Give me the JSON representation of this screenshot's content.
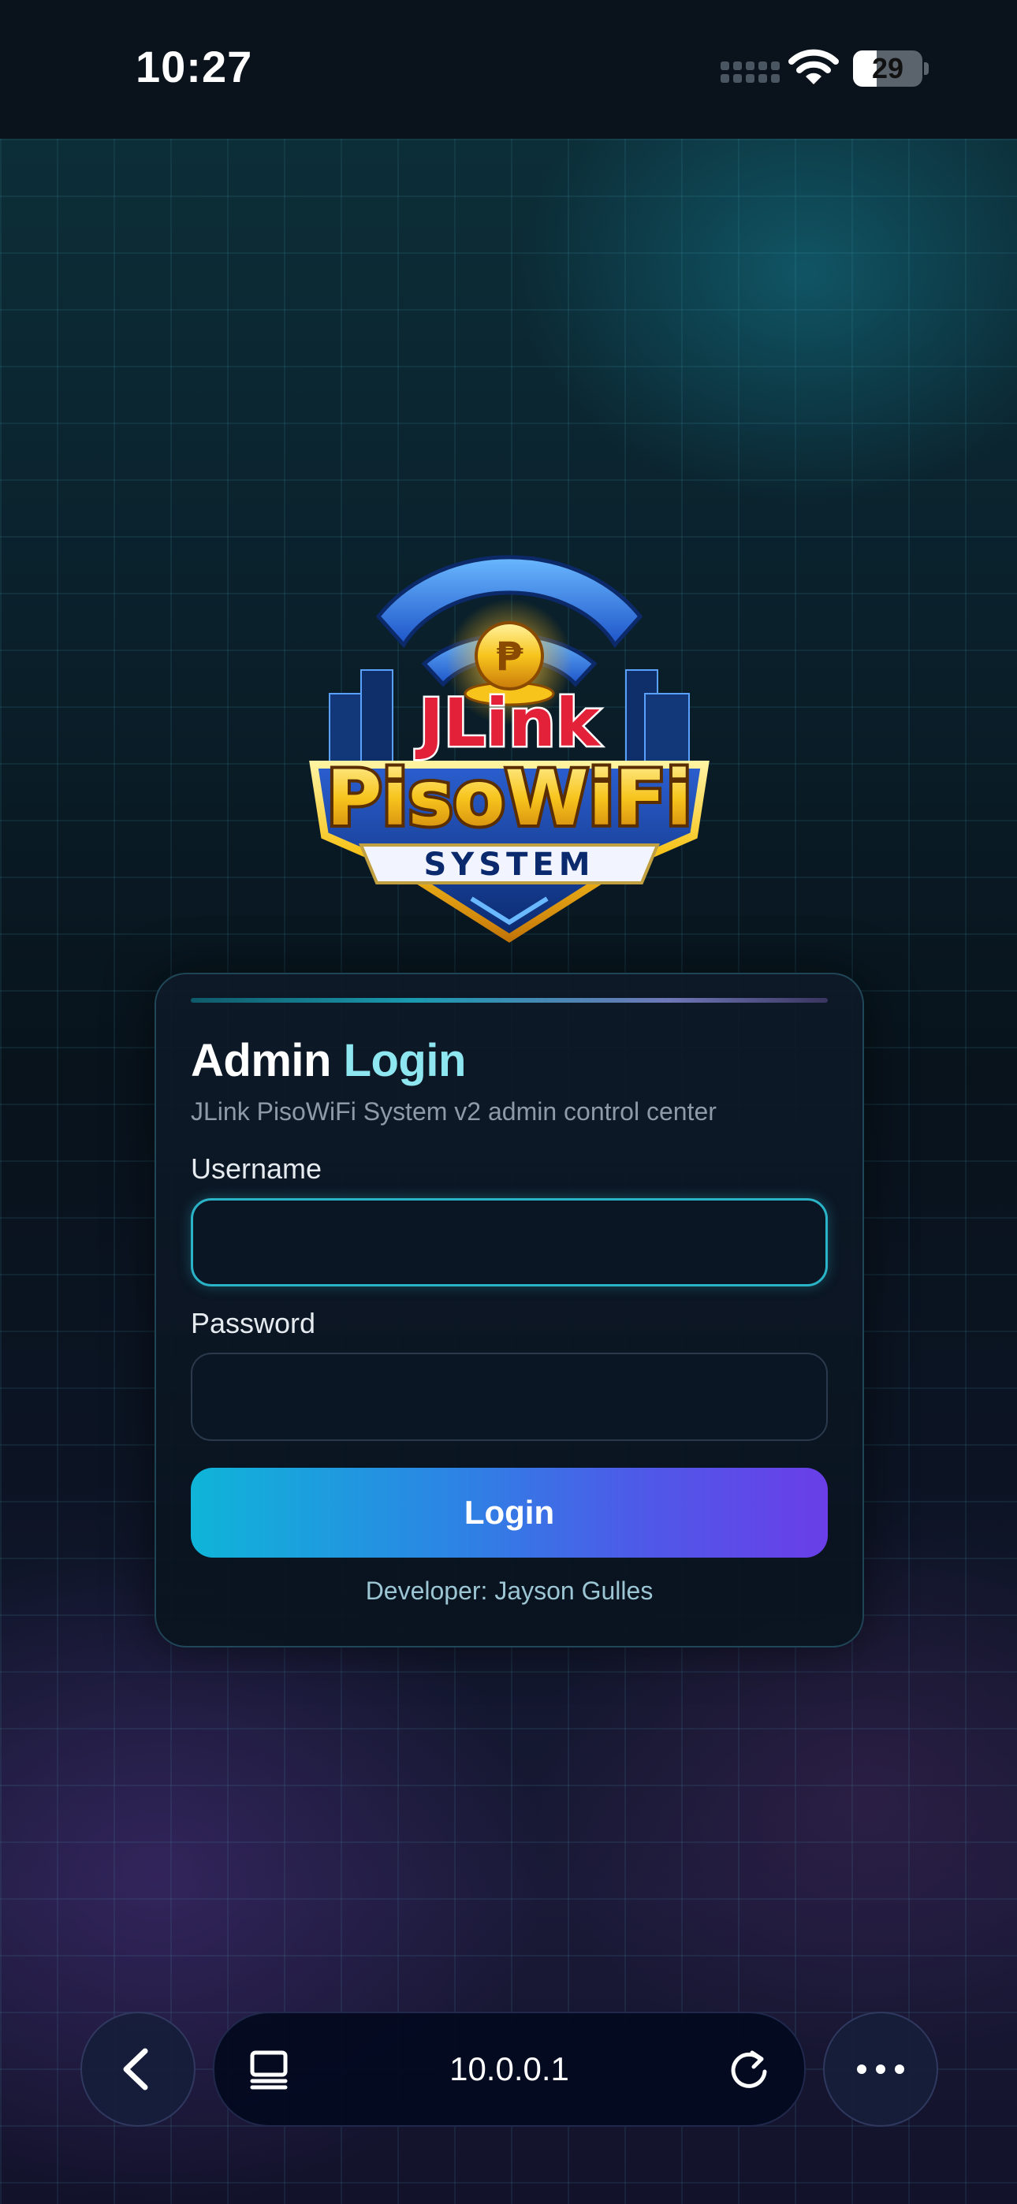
{
  "status_bar": {
    "time": "10:27",
    "battery": "29",
    "icons": [
      "cellular-signal-icon",
      "wifi-icon",
      "battery-icon"
    ]
  },
  "logo": {
    "line1": "JLink",
    "line2": "PisoWiFi",
    "line3": "SYSTEM",
    "coin_symbol": "₱"
  },
  "login": {
    "title_main": "Admin",
    "title_accent": "Login",
    "subtitle": "JLink PisoWiFi System v2 admin control center",
    "username_label": "Username",
    "username_value": "",
    "password_label": "Password",
    "password_value": "",
    "submit_label": "Login",
    "developer": "Developer: Jayson Gulles"
  },
  "browser": {
    "url": "10.0.0.1",
    "icons": [
      "back-icon",
      "tabs-icon",
      "reload-icon",
      "more-icon"
    ]
  },
  "colors": {
    "accent": "#8ee6f0",
    "button_start": "#0fb5d8",
    "button_end": "#6a3ee8",
    "focus_border": "#2bb3c8"
  }
}
